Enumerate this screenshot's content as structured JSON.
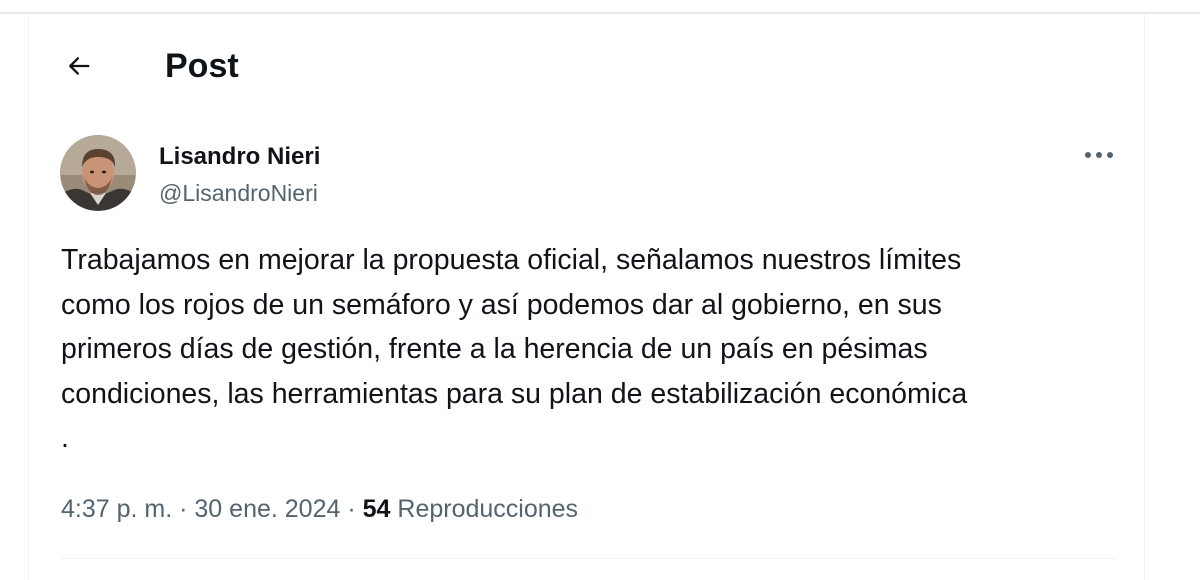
{
  "header": {
    "back_icon": "arrow-left-icon",
    "title": "Post"
  },
  "author": {
    "display_name": "Lisandro Nieri",
    "handle": "@LisandroNieri",
    "avatar_icon": "avatar-photo"
  },
  "more_icon": "more-horizontal-icon",
  "post": {
    "text": "Trabajamos en mejorar la propuesta oficial, señalamos nuestros límites\ncomo los rojos de un semáforo y así podemos dar al gobierno, en sus\nprimeros días de gestión, frente a la herencia de un país en pésimas\ncondiciones, las herramientas para su plan de estabilización económica\n."
  },
  "meta": {
    "time": "4:37 p. m.",
    "separator": "·",
    "date": "30 ene. 2024",
    "views_count": "54",
    "views_label": "Reproducciones"
  },
  "colors": {
    "text_primary": "#0f1419",
    "text_secondary": "#536471",
    "border": "#eff3f4"
  }
}
